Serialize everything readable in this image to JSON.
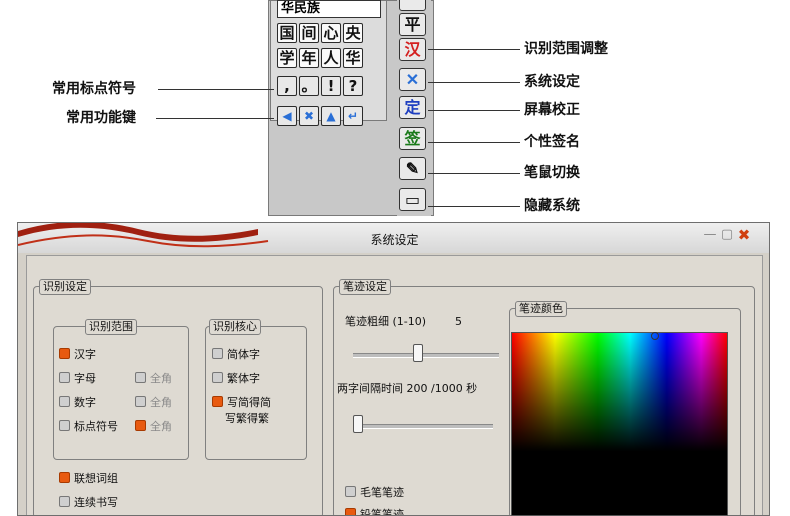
{
  "input_panel": {
    "candidate_text": "华民族",
    "char_rows": [
      [
        "国",
        "间",
        "心",
        "央"
      ],
      [
        "学",
        "年",
        "人",
        "华"
      ]
    ],
    "punct_row": [
      ",",
      "。",
      "!",
      "?"
    ],
    "func_row": [
      {
        "icon": "arrow-left-icon",
        "glyph": "◀",
        "color": "#2a6fd6"
      },
      {
        "icon": "delete-x-icon",
        "glyph": "✖",
        "color": "#2a6fd6"
      },
      {
        "icon": "arrow-up-icon",
        "glyph": "▲",
        "color": "#2a6fd6"
      },
      {
        "icon": "enter-icon",
        "glyph": "↵",
        "color": "#2a6fd6"
      }
    ],
    "tools": [
      {
        "icon": "unknown-partial-icon",
        "glyph": "",
        "color": "#333333"
      },
      {
        "icon": "ping-char-icon",
        "glyph": "平",
        "color": "#111111"
      },
      {
        "icon": "han-char-icon",
        "glyph": "汉",
        "color": "#d42020"
      },
      {
        "icon": "tools-icon",
        "glyph": "✕",
        "color": "#2a6fd6"
      },
      {
        "icon": "ding-char-icon",
        "glyph": "定",
        "color": "#1f3fc0"
      },
      {
        "icon": "signature-icon",
        "glyph": "签",
        "color": "#1a7a1a"
      },
      {
        "icon": "pen-mouse-icon",
        "glyph": "✎",
        "color": "#111111"
      },
      {
        "icon": "window-hide-icon",
        "glyph": "▭",
        "color": "#111111"
      }
    ]
  },
  "callouts": {
    "left": [
      "常用标点符号",
      "常用功能键"
    ],
    "right": [
      "识别范围调整",
      "系统设定",
      "屏幕校正",
      "个性签名",
      "笔鼠切换",
      "隐藏系统"
    ]
  },
  "settings_window": {
    "title": "系统设定",
    "recognition": {
      "group_label": "识别设定",
      "range": {
        "label": "识别范围",
        "items": [
          {
            "label": "汉字",
            "checked": true
          },
          {
            "label": "字母",
            "checked": false
          },
          {
            "label": "数字",
            "checked": false
          },
          {
            "label": "标点符号",
            "checked": false
          }
        ],
        "fullwidth": [
          {
            "label": "全角",
            "checked": false
          },
          {
            "label": "全角",
            "checked": false
          },
          {
            "label": "全角",
            "checked": true
          }
        ]
      },
      "core": {
        "label": "识别核心",
        "items": [
          {
            "label": "简体字",
            "checked": false
          },
          {
            "label": "繁体字",
            "checked": false
          },
          {
            "label": "写简得简",
            "checked": true
          }
        ],
        "extra": "写繁得繁"
      },
      "extra_options": [
        {
          "label": "联想词组",
          "checked": true
        },
        {
          "label": "连续书写",
          "checked": false
        }
      ]
    },
    "stroke": {
      "group_label": "笔迹设定",
      "width_label": "笔迹粗细 (1-10)",
      "width_value": "5",
      "interval_label": "两字间隔时间 200 /1000 秒",
      "brush_options": [
        {
          "label": "毛笔笔迹",
          "checked": false
        },
        {
          "label": "铅笔笔迹",
          "checked": true
        }
      ],
      "color_label": "笔迹颜色"
    }
  },
  "colors": {
    "accent": "#e85a10",
    "title_wave": "#a02010",
    "close": "#d04010"
  }
}
